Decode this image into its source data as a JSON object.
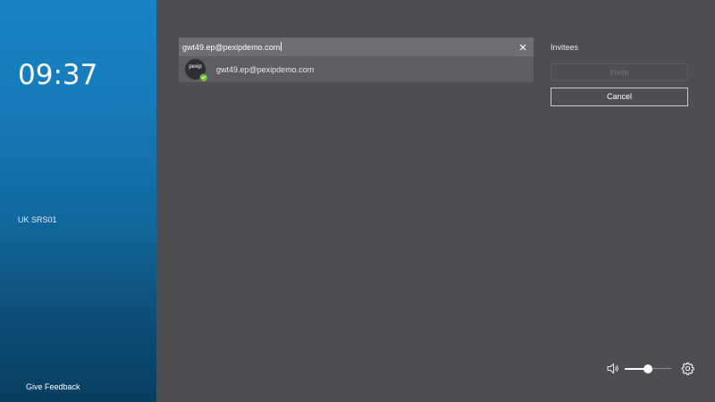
{
  "sidebar": {
    "clock": "09:37",
    "room_name": "UK SRS01",
    "feedback_label": "Give Feedback"
  },
  "search": {
    "value": "gwt49.ep@pexipdemo.com",
    "clear_icon": "close-icon"
  },
  "results": [
    {
      "avatar_text": "pexip",
      "label": "gwt49.ep@pexipdemo.com",
      "status": "available",
      "status_color": "#6fbf2e"
    }
  ],
  "invitees": {
    "title": "Invitees",
    "invite_label": "Invite",
    "cancel_label": "Cancel"
  },
  "controls": {
    "volume_icon": "speaker-icon",
    "volume_level": 0.5,
    "settings_icon": "gear-icon"
  },
  "colors": {
    "sidebar_top": "#1784c4",
    "sidebar_bottom": "#093e60",
    "background": "#4e4d52",
    "accent_available": "#6fbf2e"
  }
}
